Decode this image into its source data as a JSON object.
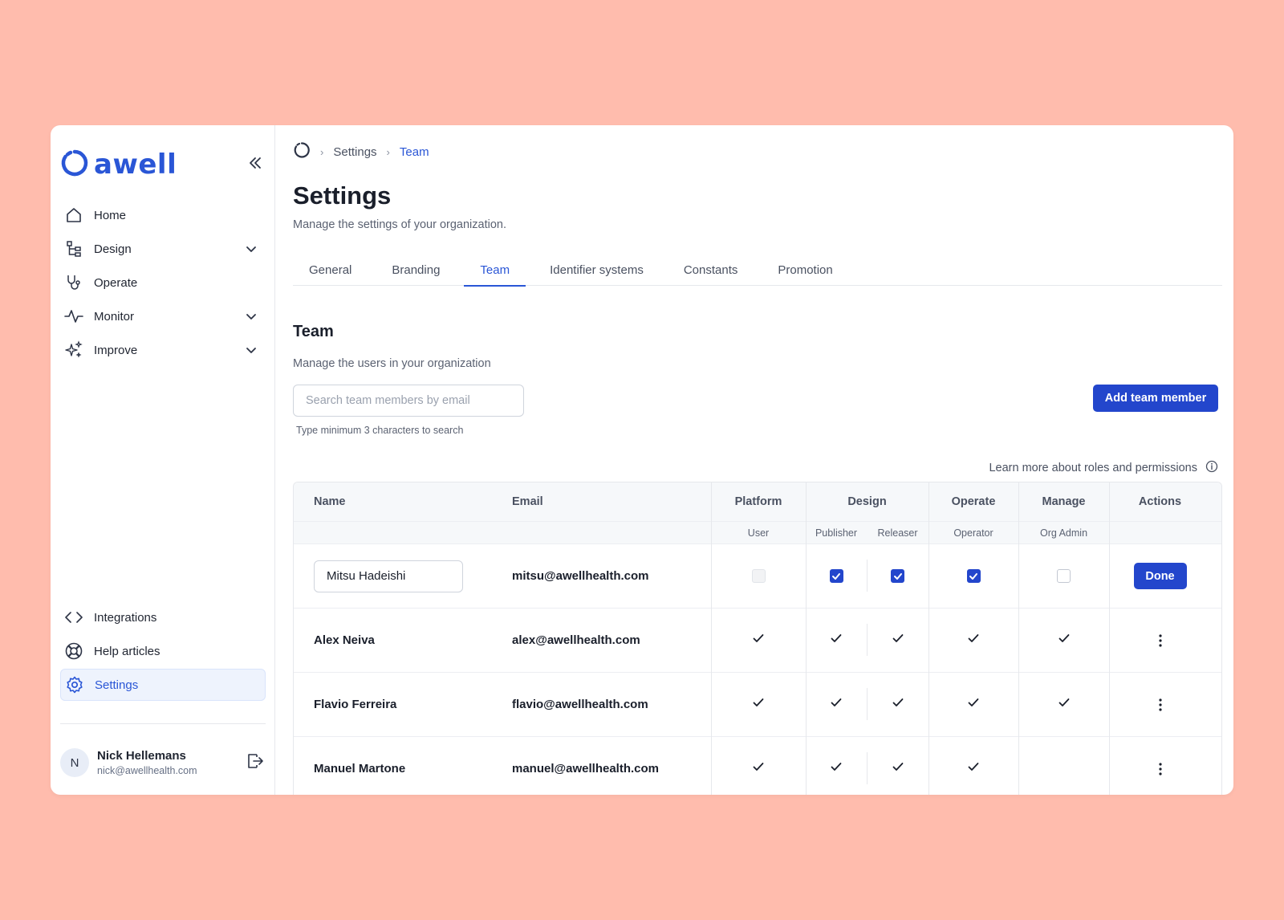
{
  "app": {
    "logo_text": "awell",
    "brand_color": "#2a56d6",
    "background_color": "#ffbcad"
  },
  "sidebar": {
    "top_items": [
      {
        "label": "Home",
        "icon": "home-icon",
        "expandable": false
      },
      {
        "label": "Design",
        "icon": "hierarchy-icon",
        "expandable": true
      },
      {
        "label": "Operate",
        "icon": "stethoscope-icon",
        "expandable": false
      },
      {
        "label": "Monitor",
        "icon": "activity-icon",
        "expandable": true
      },
      {
        "label": "Improve",
        "icon": "sparkles-icon",
        "expandable": true
      }
    ],
    "bottom_items": [
      {
        "label": "Integrations",
        "icon": "code-icon"
      },
      {
        "label": "Help articles",
        "icon": "lifebuoy-icon"
      },
      {
        "label": "Settings",
        "icon": "gear-icon",
        "active": true
      }
    ],
    "user": {
      "initial": "N",
      "name": "Nick Hellemans",
      "email": "nick@awellhealth.com"
    }
  },
  "breadcrumb": {
    "items": [
      "Settings",
      "Team"
    ]
  },
  "page": {
    "title": "Settings",
    "subtitle": "Manage the settings of your organization."
  },
  "tabs": [
    {
      "label": "General"
    },
    {
      "label": "Branding"
    },
    {
      "label": "Team",
      "active": true
    },
    {
      "label": "Identifier systems"
    },
    {
      "label": "Constants"
    },
    {
      "label": "Promotion"
    }
  ],
  "team": {
    "title": "Team",
    "subtitle": "Manage the users in your organization",
    "search_placeholder": "Search team members by email",
    "search_hint": "Type minimum 3 characters to search",
    "add_button": "Add team member",
    "learn_more": "Learn more about roles and permissions"
  },
  "table": {
    "headers": {
      "name": "Name",
      "email": "Email",
      "platform": "Platform",
      "design": "Design",
      "operate": "Operate",
      "manage": "Manage",
      "actions": "Actions"
    },
    "subheaders": {
      "user": "User",
      "publisher": "Publisher",
      "releaser": "Releaser",
      "operator": "Operator",
      "org_admin": "Org Admin"
    },
    "editing_row": {
      "name": "Mitsu Hadeishi",
      "email": "mitsu@awellhealth.com",
      "user": "disabled",
      "publisher": "checked",
      "releaser": "checked",
      "operator": "checked",
      "org_admin": "unchecked",
      "action": "Done"
    },
    "rows": [
      {
        "name": "Alex Neiva",
        "email": "alex@awellhealth.com",
        "user": true,
        "publisher": true,
        "releaser": true,
        "operator": true,
        "org_admin": true
      },
      {
        "name": "Flavio Ferreira",
        "email": "flavio@awellhealth.com",
        "user": true,
        "publisher": true,
        "releaser": true,
        "operator": true,
        "org_admin": true
      },
      {
        "name": "Manuel Martone",
        "email": "manuel@awellhealth.com",
        "user": true,
        "publisher": true,
        "releaser": true,
        "operator": true,
        "org_admin": false
      }
    ]
  }
}
